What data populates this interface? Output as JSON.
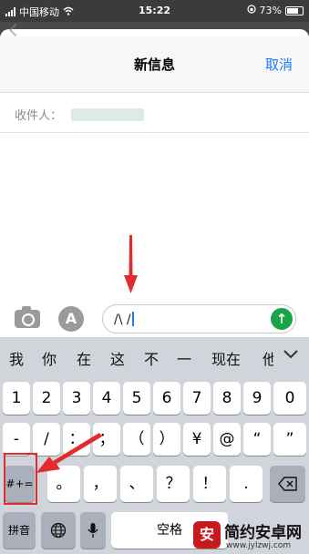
{
  "status_bar": {
    "carrier": "中国移动",
    "time": "15:22",
    "battery": "73%"
  },
  "nav": {
    "title": "新信息",
    "cancel_label": "取消"
  },
  "recipient": {
    "label": "收件人："
  },
  "compose": {
    "text": "/\\ /",
    "send_icon": "↑",
    "app_icon": "A"
  },
  "candidates": [
    "我",
    "你",
    "在",
    "这",
    "不",
    "一",
    "现在",
    "他"
  ],
  "keyboard": {
    "row_numbers": [
      "1",
      "2",
      "3",
      "4",
      "5",
      "6",
      "7",
      "8",
      "9",
      "0"
    ],
    "row_symbols": [
      "-",
      "/",
      "：",
      "；",
      "（",
      "）",
      "¥",
      "@",
      "“",
      "”"
    ],
    "row_third": {
      "toggle_label": "#+=",
      "keys": [
        "。",
        "，",
        "、",
        "？",
        "！",
        "."
      ]
    },
    "row_bottom": {
      "pinyin_label": "拼音",
      "space_label": "空格"
    }
  },
  "watermark": {
    "logo": "安",
    "name": "简约安卓网",
    "url": "www.jylzwj.com"
  },
  "colors": {
    "accent": "#1a7cf5",
    "send": "#17a444",
    "annotation": "#e02c2c"
  }
}
